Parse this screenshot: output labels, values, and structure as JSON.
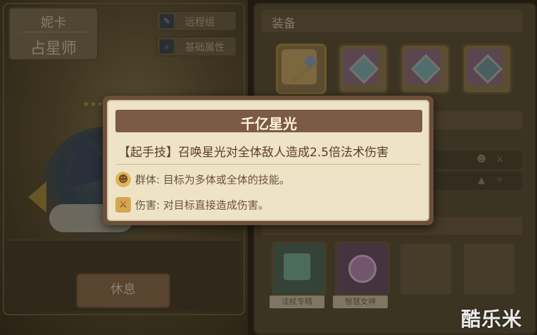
{
  "character": {
    "name": "妮卡",
    "class": "占星师",
    "tags": [
      {
        "icon": "wrench-icon",
        "label": "远程组"
      },
      {
        "icon": "magnifier-icon",
        "label": "基础属性"
      }
    ],
    "rest_button": "休息"
  },
  "equipment": {
    "header": "装备",
    "slots": [
      "wand-icon",
      "gem-icon",
      "gem-icon",
      "gem-icon"
    ],
    "skills": [
      {
        "label": "法杖专精",
        "icon": "wand-skill-icon"
      },
      {
        "label": "智慧女神",
        "icon": "medallion-icon"
      },
      {
        "label": ""
      },
      {
        "label": ""
      }
    ]
  },
  "tooltip": {
    "title": "千亿星光",
    "description": "【起手技】召唤星光对全体敌人造成2.5倍法术伤害",
    "traits": [
      {
        "icon": "group-face-icon",
        "text": "群体: 目标为多体或全体的技能。"
      },
      {
        "icon": "sword-icon",
        "text": "伤害: 对目标直接造成伤害。"
      }
    ]
  },
  "watermark": "酷乐米"
}
